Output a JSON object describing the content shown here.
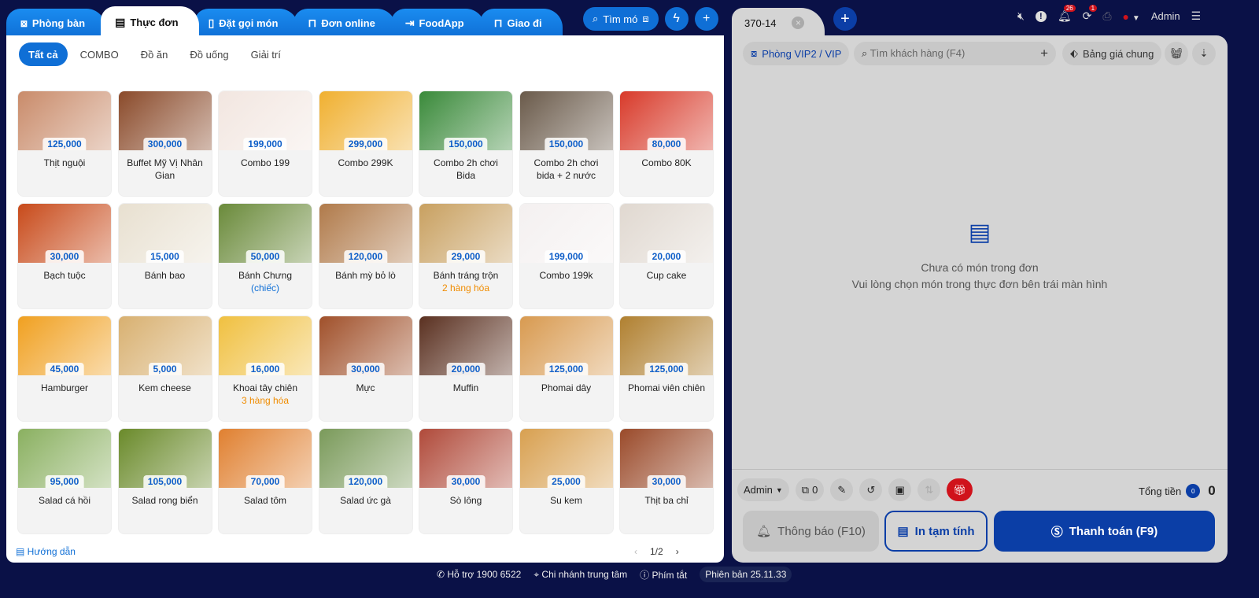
{
  "tabs": [
    {
      "label": "Phòng bàn",
      "icon": "table-icon"
    },
    {
      "label": "Thực đơn",
      "icon": "menu-icon",
      "active": true
    },
    {
      "label": "Đặt gọi món",
      "icon": "phone-order-icon"
    },
    {
      "label": "Đơn online",
      "icon": "bag-icon"
    },
    {
      "label": "FoodApp",
      "icon": "login-icon"
    },
    {
      "label": "Giao đi",
      "icon": "bag-icon"
    }
  ],
  "search_label": "Tìm mó",
  "categories": [
    "Tất cả",
    "COMBO",
    "Đồ ăn",
    "Đồ uống",
    "Giải trí"
  ],
  "items": [
    {
      "name": "Thịt nguội",
      "price": "125,000",
      "color": "#c98b6a"
    },
    {
      "name": "Buffet Mỹ Vị Nhân Gian",
      "price": "300,000",
      "color": "#8a4a2a"
    },
    {
      "name": "Combo 199",
      "price": "199,000",
      "color": "#f2e6e0"
    },
    {
      "name": "Combo 299K",
      "price": "299,000",
      "color": "#f0b030"
    },
    {
      "name": "Combo 2h chơi Bida",
      "price": "150,000",
      "color": "#3a8a3a"
    },
    {
      "name": "Combo 2h chơi bida + 2 nước",
      "price": "150,000",
      "color": "#6a5a4a"
    },
    {
      "name": "Combo 80K",
      "price": "80,000",
      "color": "#d83a2a"
    },
    {
      "name": "Bạch tuộc",
      "price": "30,000",
      "color": "#c84a1a"
    },
    {
      "name": "Bánh bao",
      "price": "15,000",
      "color": "#e8e0d0"
    },
    {
      "name": "Bánh Chưng",
      "price": "50,000",
      "sub": "(chiếc)",
      "sub_color": "#0f6fd6",
      "color": "#6a8a3a"
    },
    {
      "name": "Bánh mỳ bỏ lò",
      "price": "120,000",
      "color": "#b07a4a"
    },
    {
      "name": "Bánh tráng trộn",
      "price": "29,000",
      "sub": "2 hàng hóa",
      "sub_color": "#f08c00",
      "color": "#c8a060"
    },
    {
      "name": "Combo 199k",
      "price": "199,000",
      "color": "#f4f0f0"
    },
    {
      "name": "Cup cake",
      "price": "20,000",
      "color": "#e0d8d0"
    },
    {
      "name": "Hamburger",
      "price": "45,000",
      "color": "#f0a020"
    },
    {
      "name": "Kem cheese",
      "price": "5,000",
      "color": "#d8b070"
    },
    {
      "name": "Khoai tây chiên",
      "price": "16,000",
      "sub": "3 hàng hóa",
      "sub_color": "#f08c00",
      "color": "#f0c040"
    },
    {
      "name": "Mực",
      "price": "30,000",
      "color": "#a0502a"
    },
    {
      "name": "Muffin",
      "price": "20,000",
      "color": "#5a3020"
    },
    {
      "name": "Phomai dây",
      "price": "125,000",
      "color": "#d89a50"
    },
    {
      "name": "Phomai viên chiên",
      "price": "125,000",
      "color": "#b08030"
    },
    {
      "name": "Salad cá hồi",
      "price": "95,000",
      "color": "#8ab060"
    },
    {
      "name": "Salad rong biển",
      "price": "105,000",
      "color": "#6a8a2a"
    },
    {
      "name": "Salad tôm",
      "price": "70,000",
      "color": "#e08030"
    },
    {
      "name": "Salad ức gà",
      "price": "120,000",
      "color": "#7a9a5a"
    },
    {
      "name": "Sò lông",
      "price": "30,000",
      "color": "#b04a3a"
    },
    {
      "name": "Su kem",
      "price": "25,000",
      "color": "#d8a050"
    },
    {
      "name": "Thịt ba chỉ",
      "price": "30,000",
      "color": "#9a4a2a"
    }
  ],
  "guide": "Hướng dẫn",
  "page": "1/2",
  "order": {
    "tab": "370-14",
    "room": "Phòng VIP2 / VIP",
    "customer_placeholder": "Tìm khách hàng (F4)",
    "price_list": "Bảng giá chung",
    "user": "Admin",
    "notif_count": "26",
    "sync_count": "1",
    "empty_line1": "Chưa có món trong đơn",
    "empty_line2": "Vui lòng chọn món trong thực đơn bên trái màn hình",
    "staff": "Admin",
    "guests": "0",
    "total_label": "Tổng tiền",
    "total_qty": "0",
    "total": "0",
    "notify_btn": "Thông báo (F10)",
    "print_btn": "In tạm tính",
    "pay_btn": "Thanh toán (F9)"
  },
  "footer": {
    "support": "Hỗ trợ 1900 6522",
    "branch": "Chi nhánh trung tâm",
    "shortcuts": "Phím tắt",
    "version": "Phiên bản 25.11.33"
  },
  "colors": {
    "primary": "#0f6fd6",
    "dark_primary": "#0b3ea6",
    "accent_orange": "#f08c00",
    "gift_red": "#d0121b"
  }
}
